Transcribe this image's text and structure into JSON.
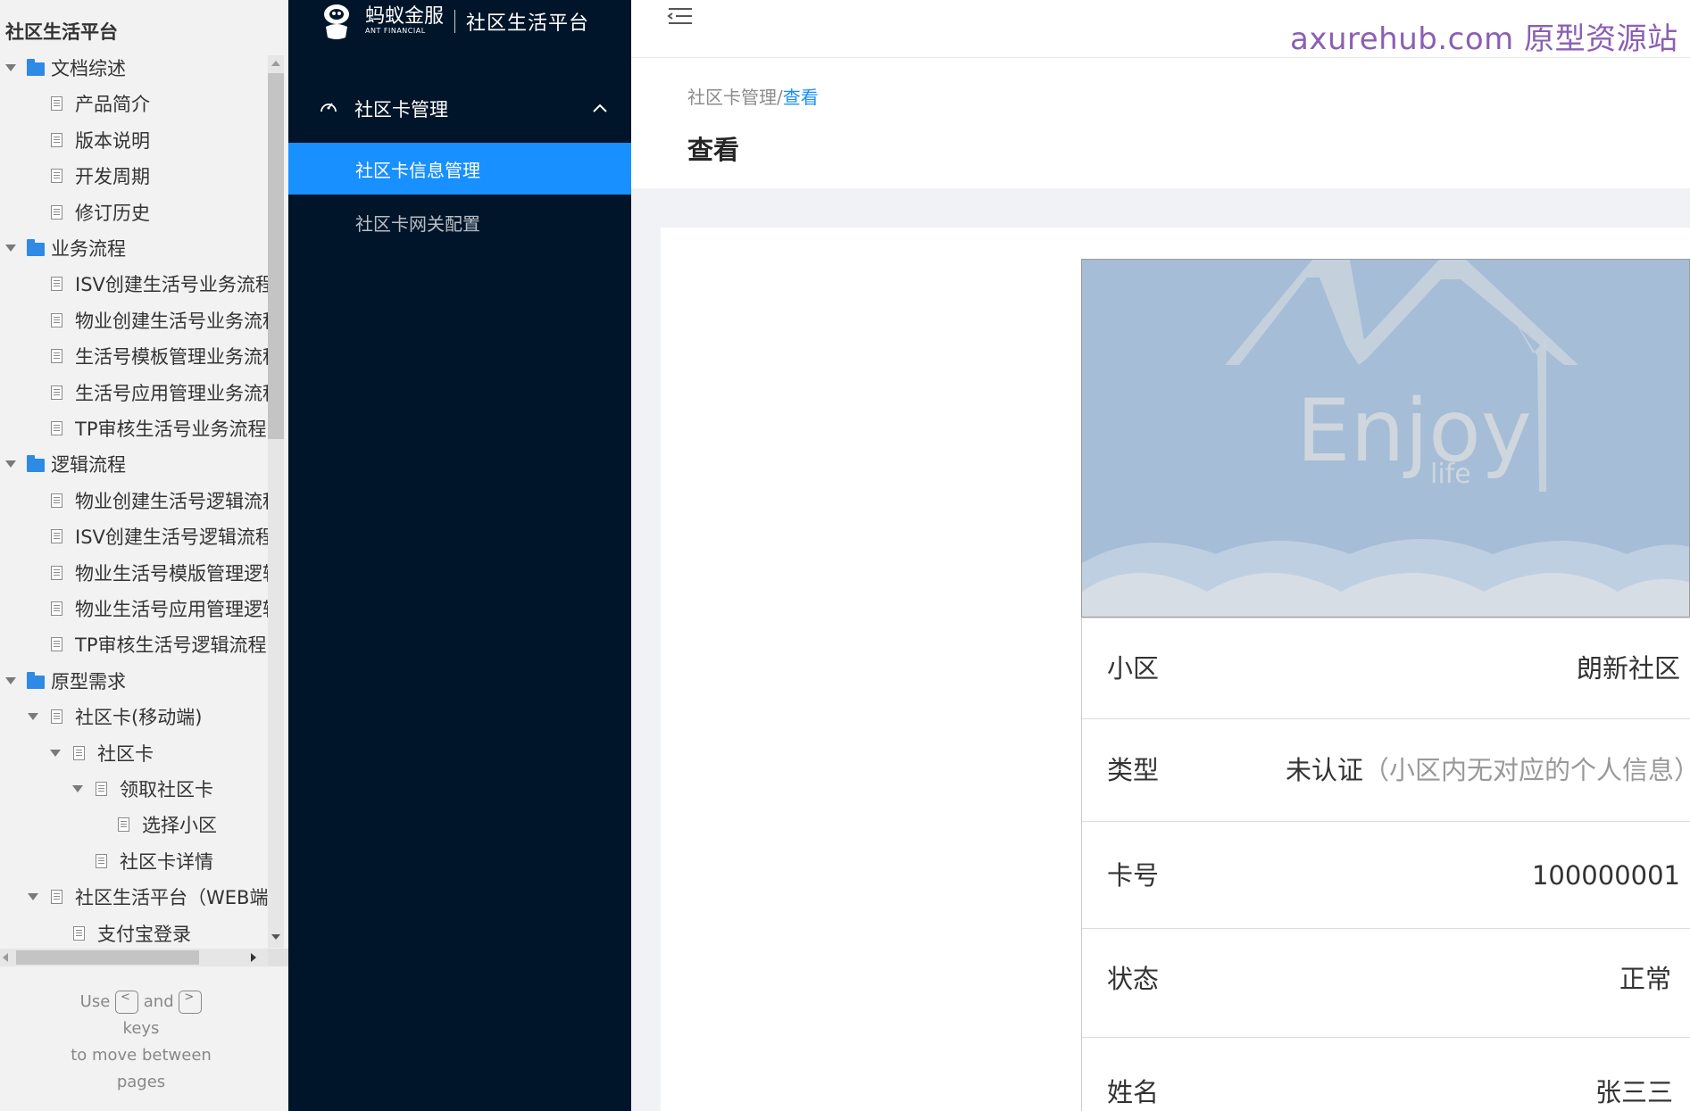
{
  "sitemap": {
    "title": "社区生活平台",
    "nodes": [
      {
        "label": "文档综述",
        "type": "folder",
        "level": 0,
        "expanded": true
      },
      {
        "label": "产品简介",
        "type": "page",
        "level": 1
      },
      {
        "label": "版本说明",
        "type": "page",
        "level": 1
      },
      {
        "label": "开发周期",
        "type": "page",
        "level": 1
      },
      {
        "label": "修订历史",
        "type": "page",
        "level": 1
      },
      {
        "label": "业务流程",
        "type": "folder",
        "level": 0,
        "expanded": true
      },
      {
        "label": "ISV创建生活号业务流程",
        "type": "page",
        "level": 1
      },
      {
        "label": "物业创建生活号业务流程",
        "type": "page",
        "level": 1
      },
      {
        "label": "生活号模板管理业务流程",
        "type": "page",
        "level": 1
      },
      {
        "label": "生活号应用管理业务流程",
        "type": "page",
        "level": 1
      },
      {
        "label": "TP审核生活号业务流程",
        "type": "page",
        "level": 1
      },
      {
        "label": "逻辑流程",
        "type": "folder",
        "level": 0,
        "expanded": true
      },
      {
        "label": "物业创建生活号逻辑流程",
        "type": "page",
        "level": 1
      },
      {
        "label": "ISV创建生活号逻辑流程",
        "type": "page",
        "level": 1
      },
      {
        "label": "物业生活号模版管理逻辑",
        "type": "page",
        "level": 1
      },
      {
        "label": "物业生活号应用管理逻辑",
        "type": "page",
        "level": 1
      },
      {
        "label": "TP审核生活号逻辑流程",
        "type": "page",
        "level": 1
      },
      {
        "label": "原型需求",
        "type": "folder",
        "level": 0,
        "expanded": true
      },
      {
        "label": "社区卡(移动端)",
        "type": "page",
        "level": 1,
        "expanded": true
      },
      {
        "label": "社区卡",
        "type": "page",
        "level": 2,
        "expanded": true
      },
      {
        "label": "领取社区卡",
        "type": "page",
        "level": 3,
        "expanded": true
      },
      {
        "label": "选择小区",
        "type": "page",
        "level": 4
      },
      {
        "label": "社区卡详情",
        "type": "page",
        "level": 3
      },
      {
        "label": "社区生活平台（WEB端）",
        "type": "page",
        "level": 1,
        "expanded": true
      },
      {
        "label": "支付宝登录",
        "type": "page",
        "level": 2
      }
    ],
    "hint": {
      "use": "Use",
      "left_key": "<",
      "and": "and",
      "right_key": ">",
      "keys": "keys",
      "move": "to move between",
      "pages": "pages"
    }
  },
  "app": {
    "logo_cn": "蚂蚁金服",
    "logo_en": "ANT FINANCIAL",
    "platform_name": "社区生活平台",
    "menu": {
      "group_label": "社区卡管理",
      "items": [
        {
          "label": "社区卡信息管理",
          "active": true
        },
        {
          "label": "社区卡网关配置",
          "active": false
        }
      ]
    },
    "watermark": "axurehub.com 原型资源站",
    "breadcrumb": {
      "parent": "社区卡管理/",
      "current": "查看"
    },
    "page_title": "查看"
  },
  "card": {
    "banner_text": "Enjoy",
    "banner_subtext": "life",
    "details": [
      {
        "label": "小区",
        "value": "朗新社区"
      },
      {
        "label": "类型",
        "value": "未认证",
        "note": "（小区内无对应的个人信息）"
      },
      {
        "label": "卡号",
        "value": "100000001"
      },
      {
        "label": "状态",
        "value": "正常"
      },
      {
        "label": "姓名",
        "value": "张三三"
      }
    ]
  },
  "colors": {
    "sidebar_bg": "#001529",
    "accent": "#1890ff",
    "folder": "#2d8ae5",
    "watermark": "#8b5fb3",
    "banner_bg": "#a5bdd6"
  }
}
